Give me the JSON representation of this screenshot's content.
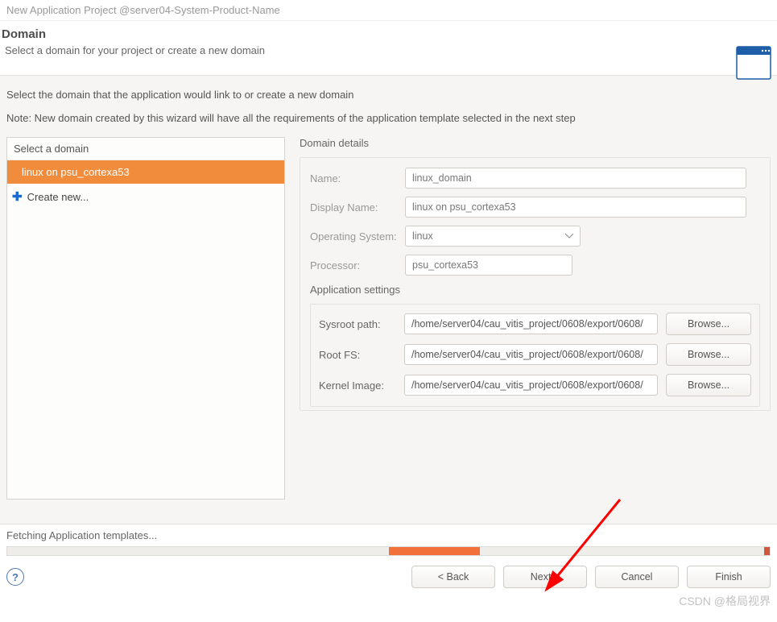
{
  "window_title": "New Application Project @server04-System-Product-Name",
  "banner": {
    "heading": "Domain",
    "subheading": "Select a domain for your project or create a new domain"
  },
  "intro": "Select the domain that the application would link to or create a new domain",
  "note": "Note: New domain created by this wizard will have all the requirements of the application template selected in the next step",
  "domain_list": {
    "header": "Select a domain",
    "selected": "linux on psu_cortexa53",
    "create_new": "Create new..."
  },
  "details": {
    "group_label": "Domain details",
    "name_label": "Name:",
    "name_value": "linux_domain",
    "display_label": "Display Name:",
    "display_value": "linux on psu_cortexa53",
    "os_label": "Operating System:",
    "os_value": "linux",
    "proc_label": "Processor:",
    "proc_value": "psu_cortexa53"
  },
  "app_settings": {
    "legend": "Application settings",
    "sysroot_label": "Sysroot path:",
    "sysroot_value": "/home/server04/cau_vitis_project/0608/export/0608/",
    "rootfs_label": "Root FS:",
    "rootfs_value": "/home/server04/cau_vitis_project/0608/export/0608/",
    "kernel_label": "Kernel Image:",
    "kernel_value": "/home/server04/cau_vitis_project/0608/export/0608/",
    "browse": "Browse..."
  },
  "status_text": "Fetching Application templates...",
  "buttons": {
    "back": "< Back",
    "next": "Next >",
    "cancel": "Cancel",
    "finish": "Finish"
  },
  "watermark": "CSDN @格局视界"
}
